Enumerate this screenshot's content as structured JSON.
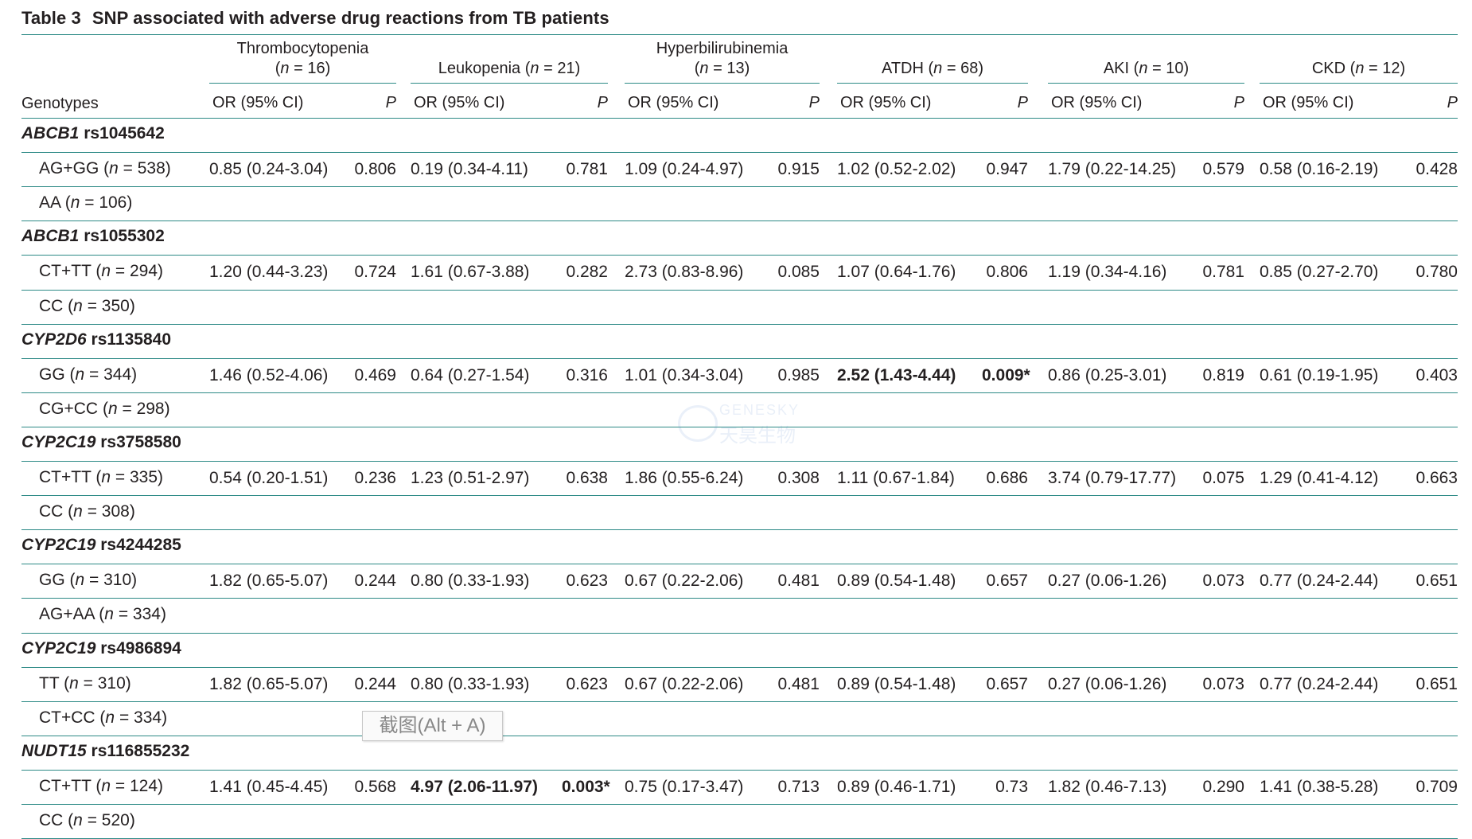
{
  "caption": {
    "label": "Table 3",
    "title": "SNP associated with adverse drug reactions from TB patients"
  },
  "columns": [
    {
      "name": "Thrombocytopenia",
      "n": "16"
    },
    {
      "name": "Leukopenia",
      "n": "21"
    },
    {
      "name": "Hyperbilirubinemia",
      "n": "13"
    },
    {
      "name": "ATDH",
      "n": "68"
    },
    {
      "name": "AKI",
      "n": "10"
    },
    {
      "name": "CKD",
      "n": "12"
    }
  ],
  "subheaders": {
    "genotypes": "Genotypes",
    "or": "OR (95% CI)",
    "p": "P"
  },
  "groups": [
    {
      "gene": "ABCB1",
      "snp": "rs1045642",
      "rows": [
        {
          "genotype": "AG+GG",
          "n": "538",
          "values": [
            [
              "0.85 (0.24-3.04)",
              "0.806"
            ],
            [
              "0.19 (0.34-4.11)",
              "0.781"
            ],
            [
              "1.09 (0.24-4.97)",
              "0.915"
            ],
            [
              "1.02 (0.52-2.02)",
              "0.947"
            ],
            [
              "1.79 (0.22-14.25)",
              "0.579"
            ],
            [
              "0.58 (0.16-2.19)",
              "0.428"
            ]
          ]
        },
        {
          "genotype": "AA",
          "n": "106",
          "values": []
        }
      ]
    },
    {
      "gene": "ABCB1",
      "snp": "rs1055302",
      "rows": [
        {
          "genotype": "CT+TT",
          "n": "294",
          "values": [
            [
              "1.20 (0.44-3.23)",
              "0.724"
            ],
            [
              "1.61 (0.67-3.88)",
              "0.282"
            ],
            [
              "2.73 (0.83-8.96)",
              "0.085"
            ],
            [
              "1.07 (0.64-1.76)",
              "0.806"
            ],
            [
              "1.19 (0.34-4.16)",
              "0.781"
            ],
            [
              "0.85 (0.27-2.70)",
              "0.780"
            ]
          ]
        },
        {
          "genotype": "CC",
          "n": "350",
          "values": []
        }
      ]
    },
    {
      "gene": "CYP2D6",
      "snp": "rs1135840",
      "rows": [
        {
          "genotype": "GG",
          "n": "344",
          "values": [
            [
              "1.46 (0.52-4.06)",
              "0.469"
            ],
            [
              "0.64 (0.27-1.54)",
              "0.316"
            ],
            [
              "1.01 (0.34-3.04)",
              "0.985"
            ],
            [
              "2.52 (1.43-4.44)",
              "0.009*"
            ],
            [
              "0.86 (0.25-3.01)",
              "0.819"
            ],
            [
              "0.61 (0.19-1.95)",
              "0.403"
            ]
          ],
          "bold": [
            3
          ]
        },
        {
          "genotype": "CG+CC",
          "n": "298",
          "values": []
        }
      ]
    },
    {
      "gene": "CYP2C19",
      "snp": "rs3758580",
      "rows": [
        {
          "genotype": "CT+TT",
          "n": "335",
          "values": [
            [
              "0.54 (0.20-1.51)",
              "0.236"
            ],
            [
              "1.23 (0.51-2.97)",
              "0.638"
            ],
            [
              "1.86 (0.55-6.24)",
              "0.308"
            ],
            [
              "1.11 (0.67-1.84)",
              "0.686"
            ],
            [
              "3.74 (0.79-17.77)",
              "0.075"
            ],
            [
              "1.29 (0.41-4.12)",
              "0.663"
            ]
          ]
        },
        {
          "genotype": "CC",
          "n": "308",
          "values": []
        }
      ]
    },
    {
      "gene": "CYP2C19",
      "snp": "rs4244285",
      "rows": [
        {
          "genotype": "GG",
          "n": "310",
          "values": [
            [
              "1.82 (0.65-5.07)",
              "0.244"
            ],
            [
              "0.80 (0.33-1.93)",
              "0.623"
            ],
            [
              "0.67 (0.22-2.06)",
              "0.481"
            ],
            [
              "0.89 (0.54-1.48)",
              "0.657"
            ],
            [
              "0.27 (0.06-1.26)",
              "0.073"
            ],
            [
              "0.77 (0.24-2.44)",
              "0.651"
            ]
          ]
        },
        {
          "genotype": "AG+AA",
          "n": "334",
          "values": []
        }
      ]
    },
    {
      "gene": "CYP2C19",
      "snp": "rs4986894",
      "rows": [
        {
          "genotype": "TT",
          "n": "310",
          "values": [
            [
              "1.82 (0.65-5.07)",
              "0.244"
            ],
            [
              "0.80 (0.33-1.93)",
              "0.623"
            ],
            [
              "0.67 (0.22-2.06)",
              "0.481"
            ],
            [
              "0.89 (0.54-1.48)",
              "0.657"
            ],
            [
              "0.27 (0.06-1.26)",
              "0.073"
            ],
            [
              "0.77 (0.24-2.44)",
              "0.651"
            ]
          ]
        },
        {
          "genotype": "CT+CC",
          "n": "334",
          "values": []
        }
      ]
    },
    {
      "gene": "NUDT15",
      "snp": "rs116855232",
      "rows": [
        {
          "genotype": "CT+TT",
          "n": "124",
          "values": [
            [
              "1.41 (0.45-4.45)",
              "0.568"
            ],
            [
              "4.97 (2.06-11.97)",
              "0.003*"
            ],
            [
              "0.75 (0.17-3.47)",
              "0.713"
            ],
            [
              "0.89 (0.46-1.71)",
              "0.73"
            ],
            [
              "1.82 (0.46-7.13)",
              "0.290"
            ],
            [
              "1.41 (0.38-5.28)",
              "0.709"
            ]
          ],
          "bold": [
            1
          ]
        },
        {
          "genotype": "CC",
          "n": "520",
          "values": []
        }
      ]
    }
  ],
  "watermark": {
    "en": "GENESKY",
    "zh": "天昊生物"
  },
  "tooltip": "截图(Alt + A)"
}
